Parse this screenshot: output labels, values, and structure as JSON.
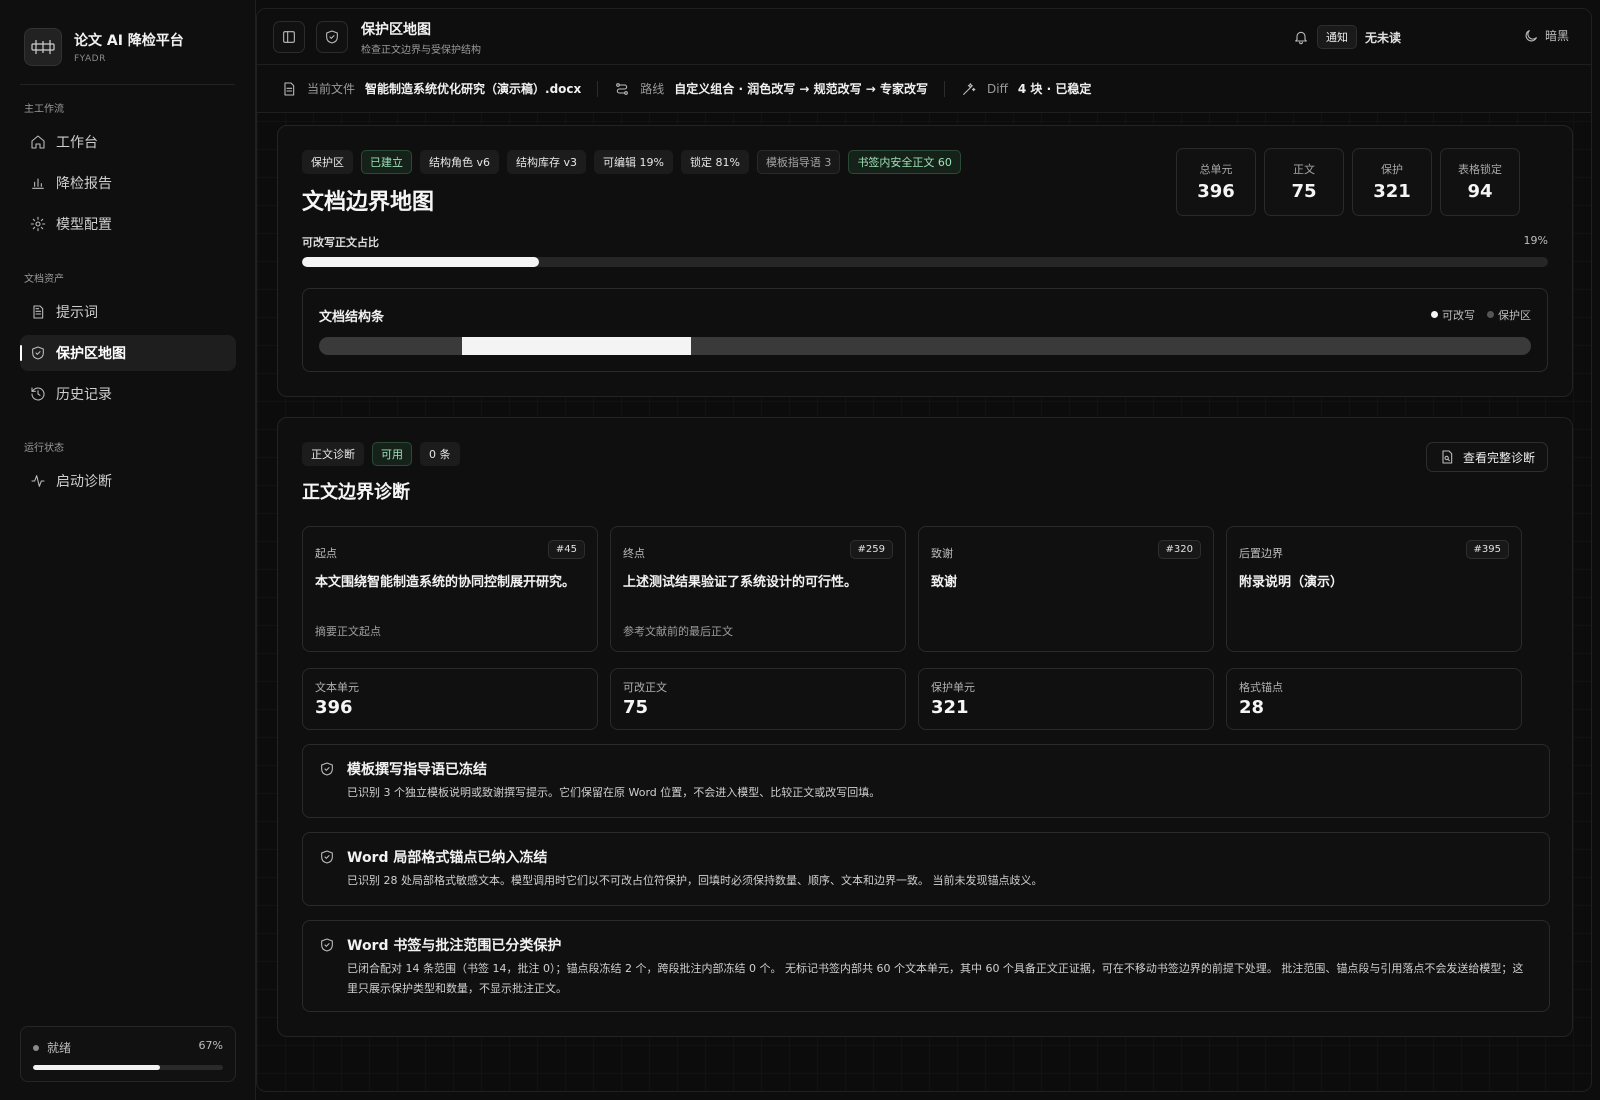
{
  "brand": {
    "title": "论文 AI 降检平台",
    "subtitle": "FYADR"
  },
  "sidebar": {
    "sections": [
      {
        "title": "主工作流"
      },
      {
        "title": "文档资产"
      },
      {
        "title": "运行状态"
      }
    ],
    "items": [
      {
        "label": "工作台",
        "icon": "home-icon"
      },
      {
        "label": "降检报告",
        "icon": "bar-chart-icon"
      },
      {
        "label": "模型配置",
        "icon": "gear-icon"
      },
      {
        "label": "提示词",
        "icon": "document-icon"
      },
      {
        "label": "保护区地图",
        "icon": "shield-icon",
        "active": true
      },
      {
        "label": "历史记录",
        "icon": "history-icon"
      },
      {
        "label": "启动诊断",
        "icon": "activity-icon"
      }
    ],
    "status": {
      "label": "就绪",
      "percent_text": "67%",
      "progress": 0.67
    }
  },
  "header": {
    "title": "保护区地图",
    "subtitle": "检查正文边界与受保护结构",
    "notify_badge": "通知",
    "notify_text": "无未读",
    "theme_label": "暗黑"
  },
  "infobar": {
    "file_label": "当前文件",
    "file_value": "智能制造系统优化研究（演示稿）.docx",
    "route_label": "路线",
    "route_value": "自定义组合 · 润色改写 → 规范改写 → 专家改写",
    "diff_label": "Diff",
    "diff_value": "4 块 · 已稳定"
  },
  "protect": {
    "tags": [
      "保护区",
      "已建立",
      "结构角色 v6",
      "结构库存 v3",
      "可编辑 19%",
      "锁定 81%",
      "模板指导语 3",
      "书签内安全正文 60"
    ],
    "title": "文档边界地图",
    "stats": [
      {
        "label": "总单元",
        "value": "396"
      },
      {
        "label": "正文",
        "value": "75"
      },
      {
        "label": "保护",
        "value": "321"
      },
      {
        "label": "表格锁定",
        "value": "94"
      }
    ],
    "ratio_label": "可改写正文占比",
    "ratio_text": "19%",
    "ratio": 0.19,
    "structure_title": "文档结构条",
    "legend_editable": "可改写",
    "legend_protected": "保护区",
    "editable_segment": {
      "start": 0.118,
      "end": 0.307
    },
    "colors": {
      "editable": "#f4f4f4",
      "protected": "#3a3a3a"
    }
  },
  "diagnosis": {
    "tags": [
      "正文诊断",
      "可用",
      "0 条"
    ],
    "title": "正文边界诊断",
    "button_label": "查看完整诊断",
    "boundaries": [
      {
        "key": "起点",
        "index": "#45",
        "text": "本文围绕智能制造系统的协同控制展开研究。",
        "note": "摘要正文起点"
      },
      {
        "key": "终点",
        "index": "#259",
        "text": "上述测试结果验证了系统设计的可行性。",
        "note": "参考文献前的最后正文"
      },
      {
        "key": "致谢",
        "index": "#320",
        "text": "致谢",
        "note": ""
      },
      {
        "key": "后置边界",
        "index": "#395",
        "text": "附录说明（演示）",
        "note": ""
      }
    ],
    "metrics": [
      {
        "label": "文本单元",
        "value": "396"
      },
      {
        "label": "可改正文",
        "value": "75"
      },
      {
        "label": "保护单元",
        "value": "321"
      },
      {
        "label": "格式锚点",
        "value": "28"
      }
    ],
    "notes": [
      {
        "title": "模板撰写指导语已冻结",
        "text": "已识别 3 个独立模板说明或致谢撰写提示。它们保留在原 Word 位置，不会进入模型、比较正文或改写回填。"
      },
      {
        "title": "Word 局部格式锚点已纳入冻结",
        "text": "已识别 28 处局部格式敏感文本。模型调用时它们以不可改占位符保护，回填时必须保持数量、顺序、文本和边界一致。 当前未发现锚点歧义。"
      },
      {
        "title": "Word 书签与批注范围已分类保护",
        "text": "已闭合配对 14 条范围（书签 14，批注 0）；锚点段冻结 2 个，跨段批注内部冻结 0 个。 无标记书签内部共 60 个文本单元，其中 60 个具备正文正证据，可在不移动书签边界的前提下处理。 批注范围、锚点段与引用落点不会发送给模型；这里只展示保护类型和数量，不显示批注正文。"
      }
    ]
  }
}
